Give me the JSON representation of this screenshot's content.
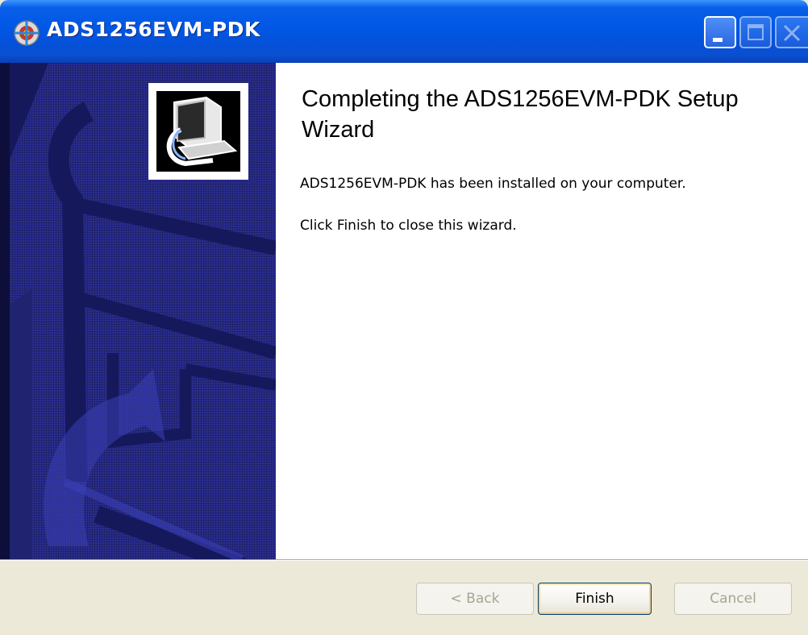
{
  "window": {
    "title": "ADS1256EVM-PDK",
    "title_icon": "installer-disc-icon"
  },
  "title_buttons": {
    "minimize_icon": "minimize-icon",
    "maximize_icon": "maximize-icon",
    "close_icon": "close-icon"
  },
  "side_panel": {
    "logo_icon": "computer-install-icon",
    "colors": {
      "background": "#2a2d8e",
      "frame": "#0d0f3a",
      "highlight": "#3a3fb5"
    }
  },
  "content": {
    "heading": "Completing the ADS1256EVM-PDK Setup Wizard",
    "installed_message": "ADS1256EVM-PDK has been installed on your computer.",
    "finish_instruction": "Click Finish to close this wizard."
  },
  "buttons": {
    "back_label": "< Back",
    "finish_label": "Finish",
    "cancel_label": "Cancel"
  },
  "colors": {
    "titlebar": "#0058e6",
    "dialog_background": "#ece9d8",
    "content_background": "#ffffff",
    "disabled_text": "#a7a692"
  }
}
